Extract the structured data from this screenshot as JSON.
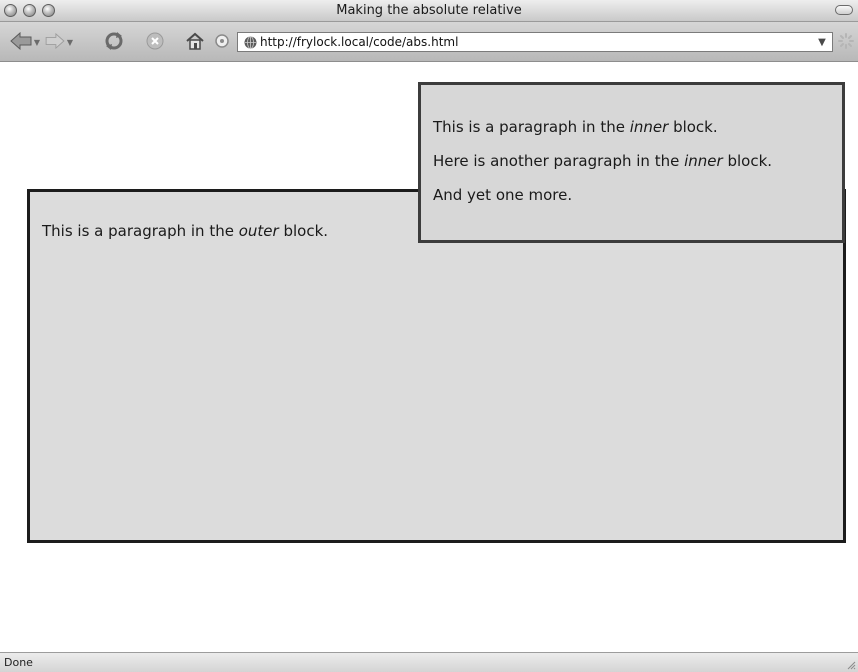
{
  "window": {
    "title": "Making the absolute relative"
  },
  "toolbar": {
    "back_icon": "back-arrow-icon",
    "forward_icon": "forward-arrow-icon",
    "reload_icon": "reload-icon",
    "stop_icon": "stop-icon",
    "home_icon": "home-icon",
    "history_icon": "history-icon",
    "url": "http://frylock.local/code/abs.html"
  },
  "page": {
    "outer": {
      "text_before": "This is a paragraph in the ",
      "emphasis": "outer",
      "text_after": " block."
    },
    "inner": {
      "paragraphs": [
        {
          "before": "This is a paragraph in the ",
          "emphasis": "inner",
          "after": " block."
        },
        {
          "before": "Here is another paragraph in the ",
          "emphasis": "inner",
          "after": " block."
        },
        {
          "text": "And yet one more."
        }
      ]
    }
  },
  "status": {
    "text": "Done"
  },
  "colors": {
    "block_background": "#dcdcdc",
    "outer_border": "#1c1c1c",
    "inner_border": "#3c3c3c"
  }
}
